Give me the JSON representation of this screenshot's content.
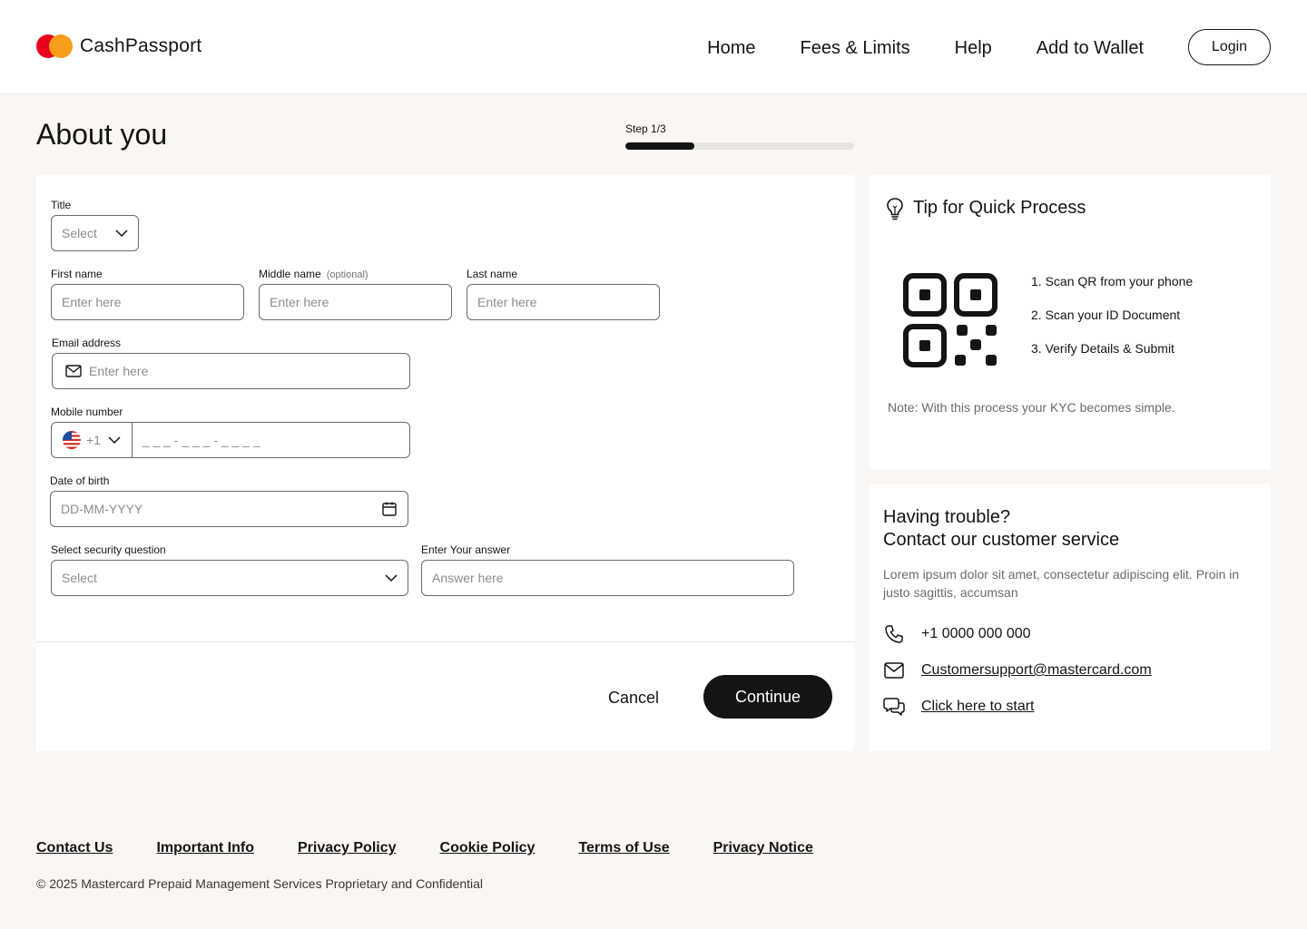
{
  "brand": {
    "name": "CashPassport",
    "logo_icon": "mastercard-circles-icon"
  },
  "nav": {
    "items": [
      "Home",
      "Fees & Limits",
      "Help",
      "Add to Wallet"
    ],
    "login_label": "Login"
  },
  "page": {
    "title": "About you",
    "step_label": "Step 1/3",
    "step_progress": 0.3
  },
  "form": {
    "title_label": "Title",
    "title_select": "Select",
    "first_name_label": "First name",
    "first_name_placeholder": "Enter here",
    "middle_name_label": "Middle name",
    "middle_name_optional": "(optional)",
    "middle_name_placeholder": "Enter here",
    "last_name_label": "Last name",
    "last_name_placeholder": "Enter here",
    "email_label": "Email address",
    "email_placeholder": "Enter here",
    "mobile_label": "Mobile number",
    "country_code": "+1",
    "mobile_placeholder": "_ _ _ - _ _ _ - _ _ _ _",
    "dob_label": "Date of birth",
    "dob_placeholder": "DD-MM-YYYY",
    "security_label": "Select security question",
    "security_select": "Select",
    "answer_label": "Enter Your answer",
    "answer_placeholder": "Answer here",
    "cancel_label": "Cancel",
    "continue_label": "Continue"
  },
  "tip": {
    "title": "Tip for Quick Process",
    "steps": [
      "1. Scan QR from your phone",
      "2. Scan your ID Document",
      "3. Verify Details & Submit"
    ],
    "note": "Note: With this process your KYC becomes simple."
  },
  "help": {
    "title_line1": "Having trouble?",
    "title_line2": "Contact our customer service",
    "description": "Lorem ipsum dolor sit amet, consectetur adipiscing elit. Proin in justo sagittis, accumsan",
    "phone": "+1 0000 000 000",
    "email": "Customersupport@mastercard.com",
    "chat": "Click here to start"
  },
  "footer": {
    "links": [
      "Contact Us",
      "Important Info",
      "Privacy Policy",
      "Cookie Policy",
      "Terms of Use",
      "Privacy Notice"
    ],
    "copyright": "© 2025 Mastercard Prepaid Management Services Proprietary and Confidential"
  }
}
